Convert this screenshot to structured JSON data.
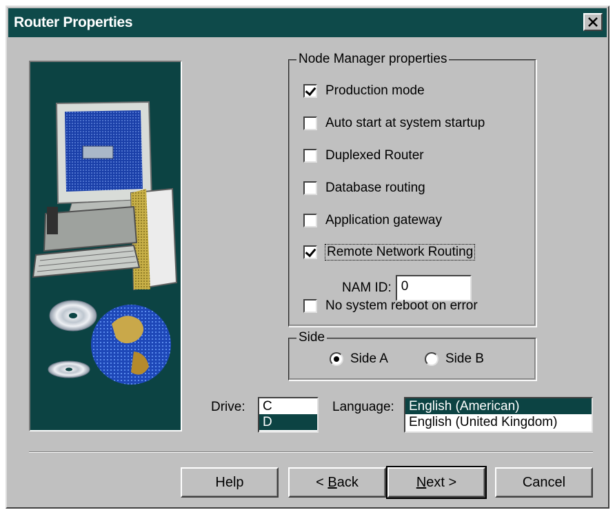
{
  "window": {
    "title": "Router Properties"
  },
  "node_manager": {
    "legend": "Node Manager properties",
    "options": [
      {
        "label": "Production mode",
        "checked": true
      },
      {
        "label": "Auto start at system startup",
        "checked": false
      },
      {
        "label": "Duplexed Router",
        "checked": false
      },
      {
        "label": "Database routing",
        "checked": false
      },
      {
        "label": "Application gateway",
        "checked": false
      },
      {
        "label": "Remote Network Routing",
        "checked": true
      },
      {
        "label": "No system reboot on error",
        "checked": false
      }
    ],
    "nam_id_label": "NAM ID:",
    "nam_id_value": "0"
  },
  "side": {
    "legend": "Side",
    "options": [
      {
        "label": "Side A",
        "selected": true
      },
      {
        "label": "Side B",
        "selected": false
      }
    ]
  },
  "drive": {
    "label": "Drive:",
    "items": [
      "C",
      "D"
    ],
    "selected": "D"
  },
  "language": {
    "label": "Language:",
    "items": [
      "English (American)",
      "English (United Kingdom)"
    ],
    "selected": "English (American)"
  },
  "buttons": {
    "help": "Help",
    "back_prefix": "< ",
    "back_mnemonic": "B",
    "back_rest": "ack",
    "next_mnemonic": "N",
    "next_rest": "ext >",
    "cancel": "Cancel"
  },
  "colors": {
    "title_bar": "#0e4a4a",
    "selection": "#0c4343",
    "face": "#c0c0c0"
  },
  "icons": {
    "close": "close-icon",
    "illustration": "computer-globe-cd-illustration"
  }
}
